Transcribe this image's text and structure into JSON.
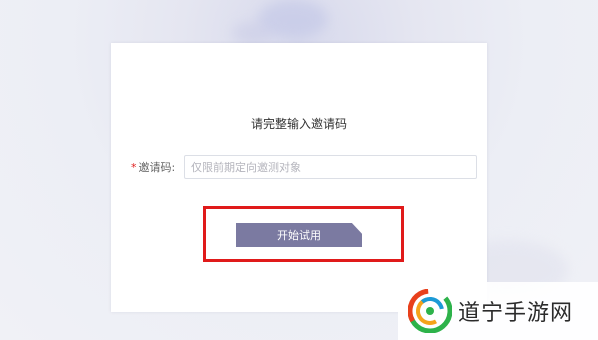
{
  "dialog": {
    "title": "请完整输入邀请码",
    "field": {
      "required_mark": "*",
      "label": "邀请码:",
      "value": "",
      "placeholder": "仅限前期定向邀测对象"
    },
    "start_button_label": "开始试用"
  },
  "colors": {
    "button": "#7b7aa1",
    "highlight": "#e01a1a",
    "required": "#e02020"
  },
  "watermark": {
    "text": "道宁手游网",
    "icon": "swirl-logo-icon"
  }
}
